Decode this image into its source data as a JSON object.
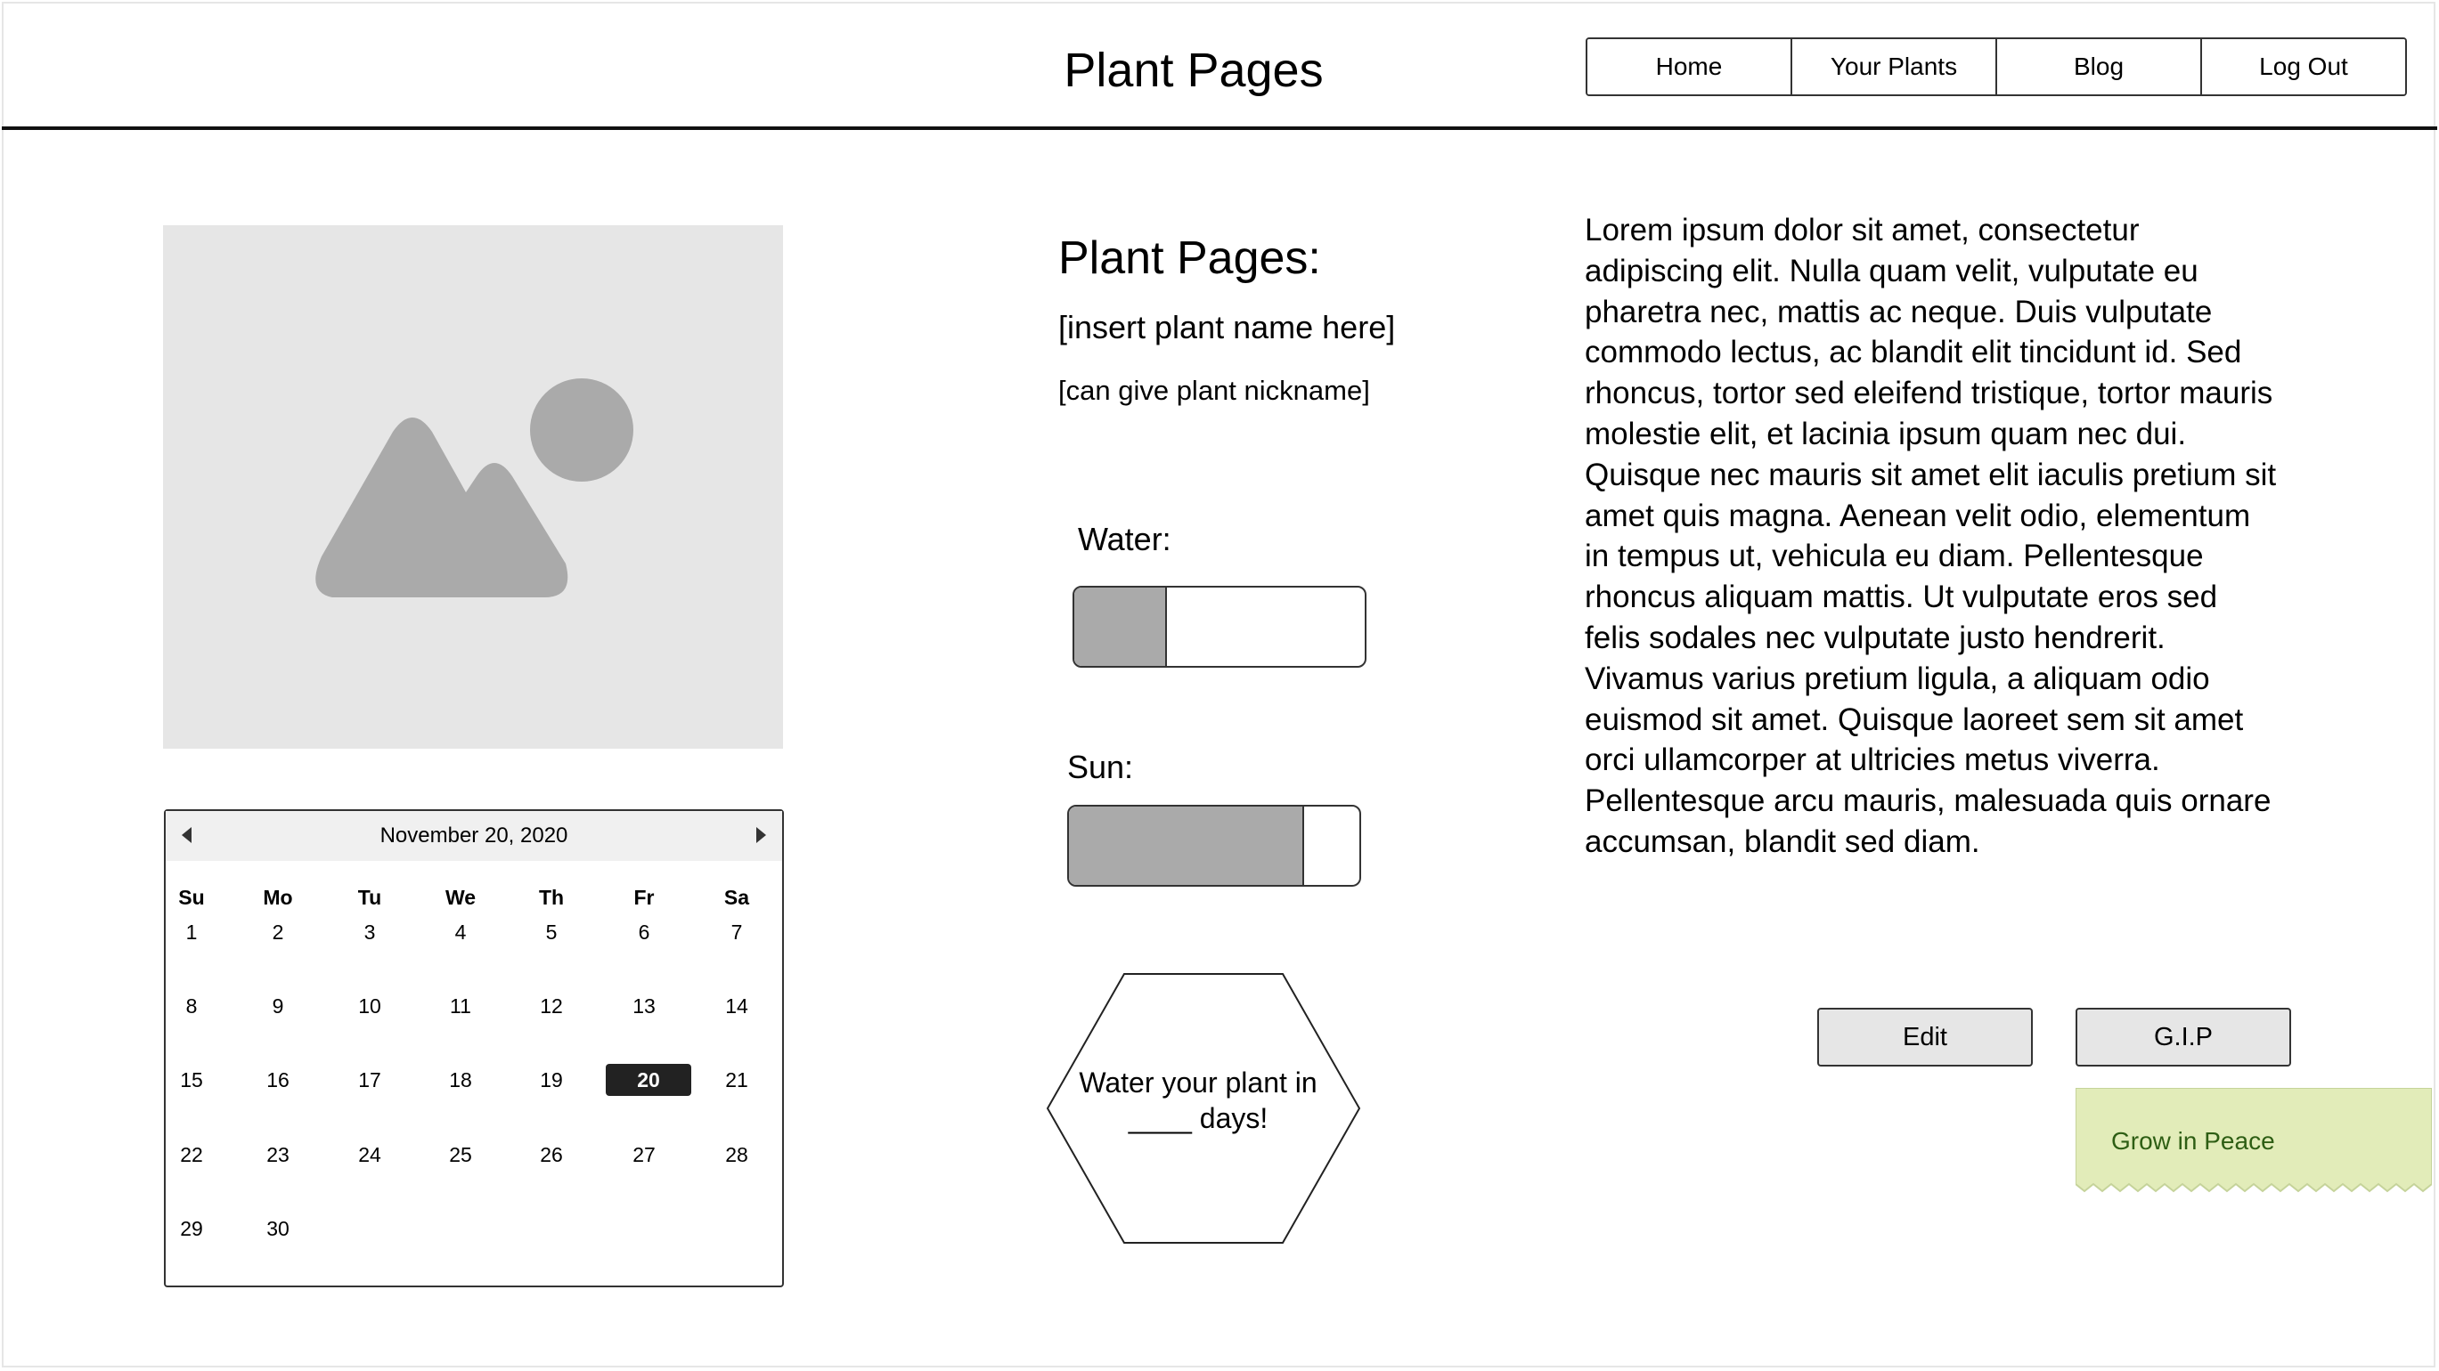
{
  "header": {
    "site_title": "Plant Pages",
    "nav": [
      "Home",
      "Your Plants",
      "Blog",
      "Log Out"
    ]
  },
  "image_placeholder": {
    "icon": "image-placeholder-icon"
  },
  "calendar": {
    "title": "November 20, 2020",
    "days_of_week": [
      "Su",
      "Mo",
      "Tu",
      "We",
      "Th",
      "Fr",
      "Sa"
    ],
    "weeks": [
      [
        "1",
        "2",
        "3",
        "4",
        "5",
        "6",
        "7"
      ],
      [
        "8",
        "9",
        "10",
        "11",
        "12",
        "13",
        "14"
      ],
      [
        "15",
        "16",
        "17",
        "18",
        "19",
        "20",
        "21"
      ],
      [
        "22",
        "23",
        "24",
        "25",
        "26",
        "27",
        "28"
      ],
      [
        "29",
        "30",
        "",
        "",
        "",
        "",
        ""
      ]
    ],
    "selected": "20"
  },
  "plant": {
    "heading": "Plant Pages:",
    "name_placeholder": "[insert plant name here]",
    "nickname_placeholder": "[can give plant nickname]"
  },
  "meters": {
    "water_label": "Water:",
    "water_level": 0.32,
    "sun_label": "Sun:",
    "sun_level": 0.81
  },
  "reminder": {
    "line1": "Water your plant in",
    "line2": "____ days!"
  },
  "description": "Lorem ipsum dolor sit amet, consectetur adipiscing elit. Nulla quam velit, vulputate eu pharetra nec, mattis ac neque. Duis vulputate commodo lectus, ac blandit elit tincidunt id. Sed rhoncus, tortor sed eleifend tristique, tortor mauris molestie elit, et lacinia ipsum quam nec dui. Quisque nec mauris sit amet elit iaculis pretium sit amet quis magna. Aenean velit odio, elementum in tempus ut, vehicula eu diam. Pellentesque rhoncus aliquam mattis. Ut vulputate eros sed felis sodales nec vulputate justo hendrerit. Vivamus varius pretium ligula, a aliquam odio euismod sit amet. Quisque laoreet sem sit amet orci ullamcorper at ultricies metus viverra. Pellentesque arcu mauris, malesuada quis ornare accumsan, blandit sed diam.",
  "actions": {
    "edit_label": "Edit",
    "gip_label": "G.I.P"
  },
  "tooltip": {
    "text": "Grow in Peace",
    "bg_color": "#e2ecb9",
    "text_color": "#2e5e14"
  }
}
